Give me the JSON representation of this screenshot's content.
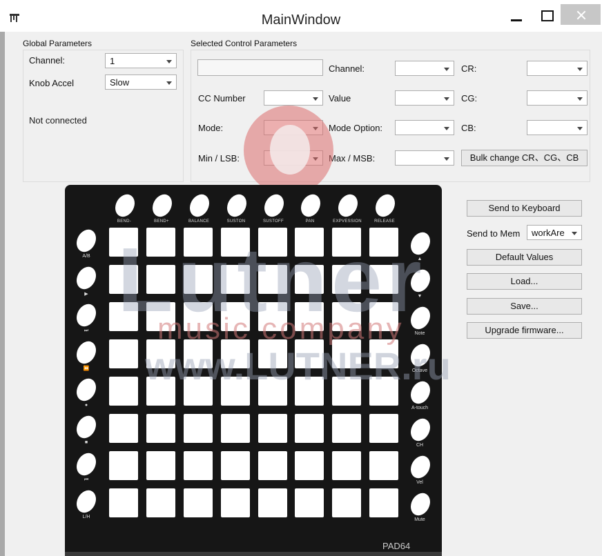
{
  "window": {
    "title": "MainWindow"
  },
  "global": {
    "title": "Global Parameters",
    "channel_label": "Channel:",
    "channel_value": "1",
    "knob_accel_label": "Knob Accel",
    "knob_accel_value": "Slow",
    "status": "Not connected"
  },
  "selected": {
    "title": "Selected Control Parameters",
    "name_value": "",
    "channel_label": "Channel:",
    "channel_value": "",
    "cr_label": "CR:",
    "cr_value": "",
    "cc_number_label": "CC Number",
    "cc_number_value": "",
    "value_label": "Value",
    "value_value": "",
    "cg_label": "CG:",
    "cg_value": "",
    "mode_label": "Mode:",
    "mode_value": "",
    "mode_option_label": "Mode Option:",
    "mode_option_value": "",
    "cb_label": "CB:",
    "cb_value": "",
    "min_label": "Min / LSB:",
    "min_value": "",
    "max_label": "Max / MSB:",
    "max_value": "",
    "bulk_button": "Bulk change CR、CG、CB"
  },
  "actions": {
    "send_keyboard": "Send to Keyboard",
    "send_mem_label": "Send to Mem",
    "send_mem_value": "workAre",
    "default_values": "Default Values",
    "load": "Load...",
    "save": "Save...",
    "upgrade": "Upgrade firmware..."
  },
  "device": {
    "model": "PAD64",
    "top_labels": [
      "BEND-",
      "BEND+",
      "BALANCE",
      "SUSTON",
      "SUSTOFF",
      "PAN",
      "EXPVESSION",
      "RELEASE"
    ],
    "left_labels": [
      "A/B",
      "▶",
      "⏭",
      "⏪",
      "●",
      "■",
      "⏮",
      "L/H"
    ],
    "right_labels": [
      "▲",
      "▼",
      "Note",
      "Octave",
      "A-touch",
      "CH",
      "Vel",
      "Mute"
    ]
  },
  "watermark": {
    "brand": "Lutner",
    "tagline": "music company",
    "url": "www.LUTNER.ru"
  }
}
